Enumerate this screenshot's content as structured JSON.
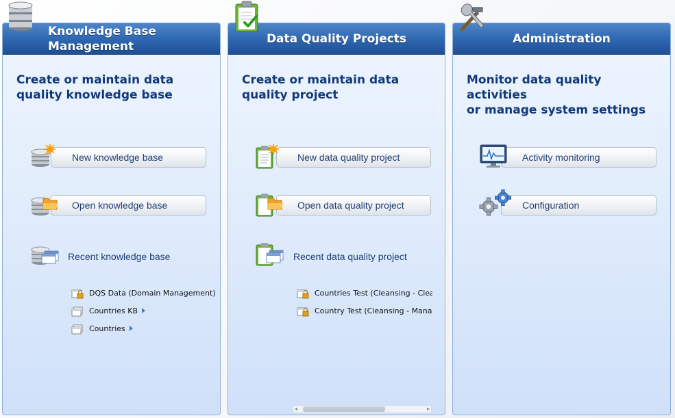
{
  "panels": {
    "knowledge_base": {
      "title": "Knowledge Base Management",
      "title_line1": "Knowledge Base",
      "title_line2": "Management",
      "description_line1": "Create or maintain data",
      "description_line2": "quality knowledge base",
      "header_icon": "database-stack-icon",
      "actions": [
        {
          "label": "New knowledge base",
          "icon": "new-knowledge-base-icon"
        },
        {
          "label": "Open knowledge base",
          "icon": "open-knowledge-base-icon"
        }
      ],
      "recent": {
        "label": "Recent knowledge base",
        "icon": "recent-knowledge-base-icon",
        "items": [
          {
            "label": "DQS Data (Domain Management)",
            "icon": "locked-kb-icon",
            "has_submenu": false
          },
          {
            "label": "Countries KB",
            "icon": "kb-item-icon",
            "has_submenu": true
          },
          {
            "label": "Countries",
            "icon": "kb-item-icon",
            "has_submenu": true
          }
        ]
      }
    },
    "data_quality": {
      "title": "Data Quality Projects",
      "description_line1": "Create or maintain data",
      "description_line2": "quality project",
      "header_icon": "clipboard-check-icon",
      "actions": [
        {
          "label": "New data quality project",
          "icon": "new-project-icon"
        },
        {
          "label": "Open data quality project",
          "icon": "open-project-icon"
        }
      ],
      "recent": {
        "label": "Recent data quality project",
        "icon": "recent-project-icon",
        "items": [
          {
            "label": "Countries Test (Cleansing - Cleanse",
            "icon": "locked-project-icon"
          },
          {
            "label": "Country Test (Cleansing - Manage a",
            "icon": "locked-project-icon"
          }
        ]
      }
    },
    "administration": {
      "title": "Administration",
      "description_line1": "Monitor data quality activities",
      "description_line2": "or manage system settings",
      "header_icon": "tools-icon",
      "actions": [
        {
          "label": "Activity monitoring",
          "icon": "monitor-icon"
        },
        {
          "label": "Configuration",
          "icon": "gears-icon"
        }
      ]
    }
  },
  "colors": {
    "header_blue": "#2d66b0",
    "title_text": "#ffffff",
    "desc_text": "#12397a",
    "link_text": "#1f3d73",
    "panel_bg": "#e3eefc"
  }
}
